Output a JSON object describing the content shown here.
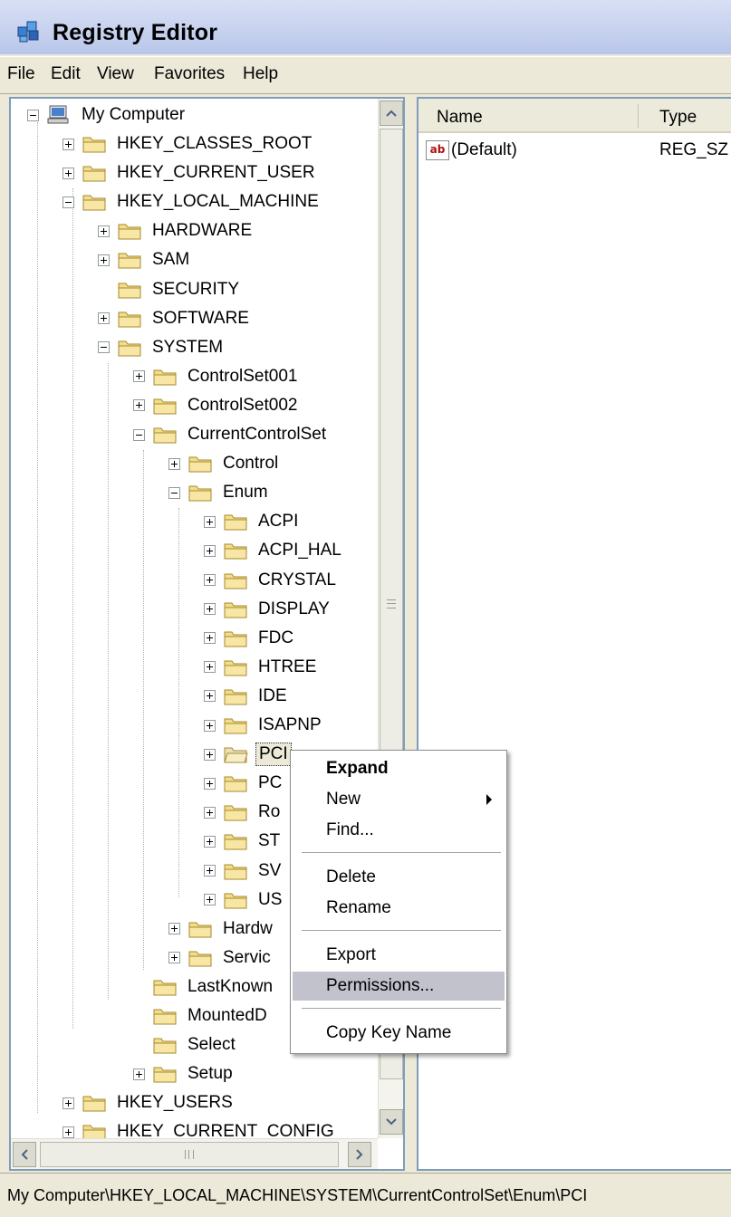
{
  "window": {
    "title": "Registry Editor"
  },
  "menu": [
    "File",
    "Edit",
    "View",
    "Favorites",
    "Help"
  ],
  "tree": {
    "root": "My Computer",
    "nodes": [
      {
        "label": "HKEY_CLASSES_ROOT"
      },
      {
        "label": "HKEY_CURRENT_USER"
      },
      {
        "label": "HKEY_LOCAL_MACHINE"
      },
      {
        "label": "HARDWARE"
      },
      {
        "label": "SAM"
      },
      {
        "label": "SECURITY"
      },
      {
        "label": "SOFTWARE"
      },
      {
        "label": "SYSTEM"
      },
      {
        "label": "ControlSet001"
      },
      {
        "label": "ControlSet002"
      },
      {
        "label": "CurrentControlSet"
      },
      {
        "label": "Control"
      },
      {
        "label": "Enum"
      },
      {
        "label": "ACPI"
      },
      {
        "label": "ACPI_HAL"
      },
      {
        "label": "CRYSTAL"
      },
      {
        "label": "DISPLAY"
      },
      {
        "label": "FDC"
      },
      {
        "label": "HTREE"
      },
      {
        "label": "IDE"
      },
      {
        "label": "ISAPNP"
      },
      {
        "label": "PCI"
      },
      {
        "label": "PC"
      },
      {
        "label": "Ro"
      },
      {
        "label": "ST"
      },
      {
        "label": "SV"
      },
      {
        "label": "US"
      },
      {
        "label": "Hardw"
      },
      {
        "label": "Servic"
      },
      {
        "label": "LastKnown"
      },
      {
        "label": "MountedD"
      },
      {
        "label": "Select"
      },
      {
        "label": "Setup"
      },
      {
        "label": "HKEY_USERS"
      },
      {
        "label": "HKEY_CURRENT_CONFIG"
      }
    ]
  },
  "list": {
    "columns": [
      "Name",
      "Type"
    ],
    "rows": [
      {
        "name": "(Default)",
        "type": "REG_SZ",
        "icon": "ab"
      }
    ]
  },
  "context_menu": {
    "items": [
      "Expand",
      "New",
      "Find...",
      "Delete",
      "Rename",
      "Export",
      "Permissions...",
      "Copy Key Name"
    ],
    "highlighted": "Permissions..."
  },
  "status": {
    "path": "My Computer\\HKEY_LOCAL_MACHINE\\SYSTEM\\CurrentControlSet\\Enum\\PCI"
  }
}
